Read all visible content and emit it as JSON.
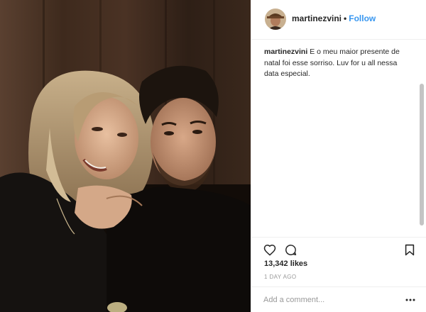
{
  "post": {
    "username": "martinezvini",
    "separator": "•",
    "follow_label": "Follow",
    "caption_text": " E o meu maior presente de natal foi esse sorriso. Luv for u all nessa data especial.",
    "likes": "13,342 likes",
    "timestamp": "1 DAY AGO",
    "comment_placeholder": "Add a comment..."
  },
  "icons": {
    "like": "heart-icon",
    "comment": "comment-bubble-icon",
    "save": "bookmark-icon",
    "more": "ellipsis-icon"
  },
  "colors": {
    "follow": "#3897f0",
    "text": "#262626",
    "muted": "#999999",
    "border": "#efefef"
  }
}
